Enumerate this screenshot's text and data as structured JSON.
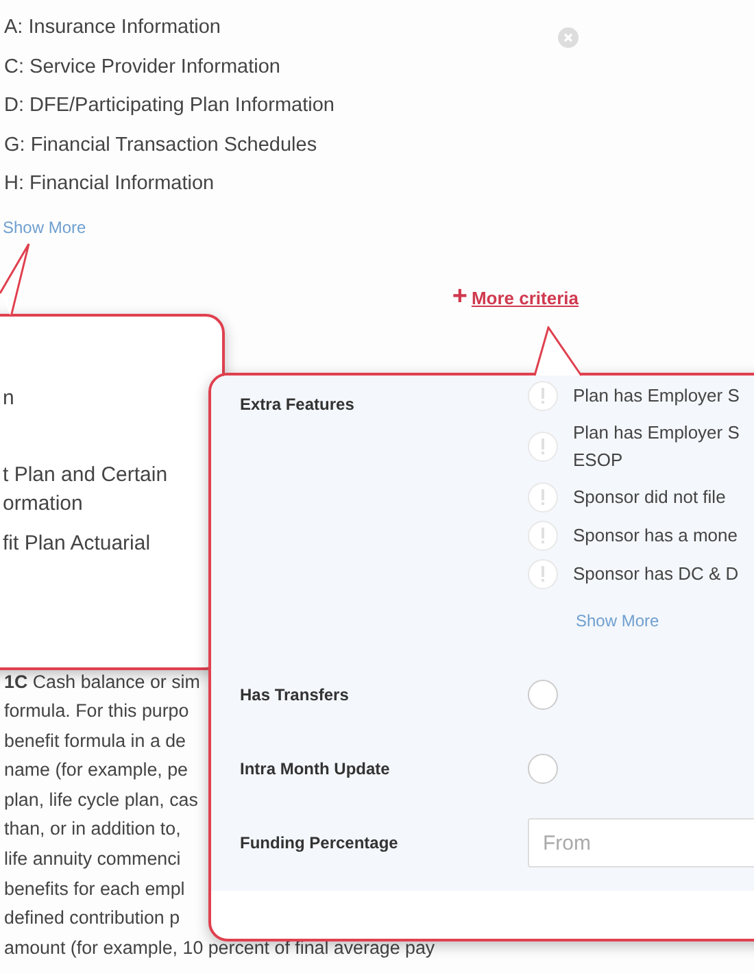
{
  "schedules": [
    {
      "label": "A: Insurance Information"
    },
    {
      "label": "C: Service Provider Information"
    },
    {
      "label": "D: DFE/Participating Plan Information"
    },
    {
      "label": "G: Financial Transaction Schedules"
    },
    {
      "label": "H: Financial Information"
    }
  ],
  "show_more": "Show More",
  "more_criteria": {
    "icon": "+",
    "label": "More criteria"
  },
  "paragraph_lines": [
    "**1C** Cash balance or sim",
    "formula. For this purpo",
    "benefit formula in a de",
    "name (for example, pe",
    "plan, life cycle plan, cas",
    "than, or in addition to,",
    "life annuity commenci",
    "benefits for each empl",
    "defined contribution p",
    "amount (for example, 10 percent of final average pay"
  ],
  "callout_left": {
    "items": [
      {
        "lines": [
          "n"
        ]
      },
      {
        "lines": [
          "t Plan and Certain",
          "ormation"
        ]
      },
      {
        "lines": [
          "fit Plan Actuarial"
        ]
      }
    ]
  },
  "callout_right": {
    "fields": [
      {
        "kind": "options",
        "label": "Extra Features",
        "options": [
          {
            "lines": [
              "Plan has Employer S"
            ],
            "checked": false,
            "disabled": true
          },
          {
            "lines": [
              "Plan has Employer S",
              "ESOP"
            ],
            "checked": false,
            "disabled": true
          },
          {
            "lines": [
              "Sponsor did not file"
            ],
            "checked": false,
            "disabled": true
          },
          {
            "lines": [
              "Sponsor has a mone"
            ],
            "checked": false,
            "disabled": true
          },
          {
            "lines": [
              "Sponsor has DC & D"
            ],
            "checked": false,
            "disabled": true
          }
        ],
        "show_more": "Show More"
      },
      {
        "kind": "radio",
        "label": "Has Transfers",
        "checked": false
      },
      {
        "kind": "radio",
        "label": "Intra Month Update",
        "checked": false
      },
      {
        "kind": "input",
        "label": "Funding Percentage",
        "placeholder": "From"
      }
    ]
  }
}
